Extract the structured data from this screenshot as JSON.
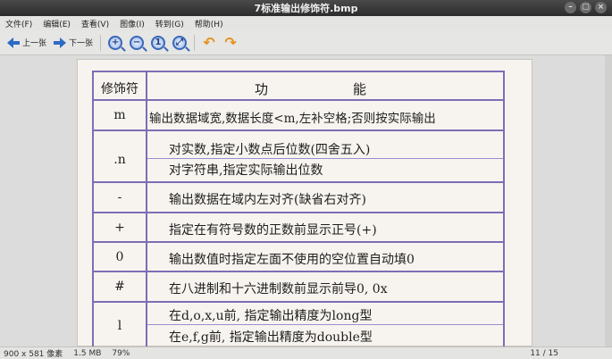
{
  "window": {
    "title": "7标准输出修饰符.bmp",
    "controls": [
      "–",
      "▢",
      "×"
    ]
  },
  "menu": [
    "文件(F)",
    "编辑(E)",
    "查看(V)",
    "图像(I)",
    "转到(G)",
    "帮助(H)"
  ],
  "toolbar": {
    "prev_label": "上一张",
    "next_label": "下一张",
    "zoom_in": "+",
    "zoom_out": "−",
    "zoom_fit": "1",
    "zoom_best": "⤢"
  },
  "table": {
    "header": {
      "symbol": "修饰符",
      "func_a": "功",
      "func_b": "能"
    },
    "rows": [
      {
        "symbol": "m",
        "lines": [
          "输出数据域宽,数据长度<m,左补空格;否则按实际输出"
        ]
      },
      {
        "symbol": ".n",
        "lines": [
          "对实数,指定小数点后位数(四舍五入)",
          "对字符串,指定实际输出位数"
        ]
      },
      {
        "symbol": "-",
        "lines": [
          "输出数据在域内左对齐(缺省右对齐)"
        ]
      },
      {
        "symbol": "+",
        "lines": [
          "指定在有符号数的正数前显示正号(+)"
        ]
      },
      {
        "symbol": "0",
        "lines": [
          "输出数值时指定左面不使用的空位置自动填0"
        ]
      },
      {
        "symbol": "#",
        "lines": [
          "在八进制和十六进制数前显示前导0, 0x"
        ]
      },
      {
        "symbol": "l",
        "lines": [
          "在d,o,x,u前, 指定输出精度为long型",
          "在e,f,g前, 指定输出精度为double型"
        ]
      }
    ]
  },
  "status": {
    "dimensions": "900 x 581 像素",
    "size": "1.5 MB",
    "zoom": "79%",
    "page": "11 / 15"
  }
}
